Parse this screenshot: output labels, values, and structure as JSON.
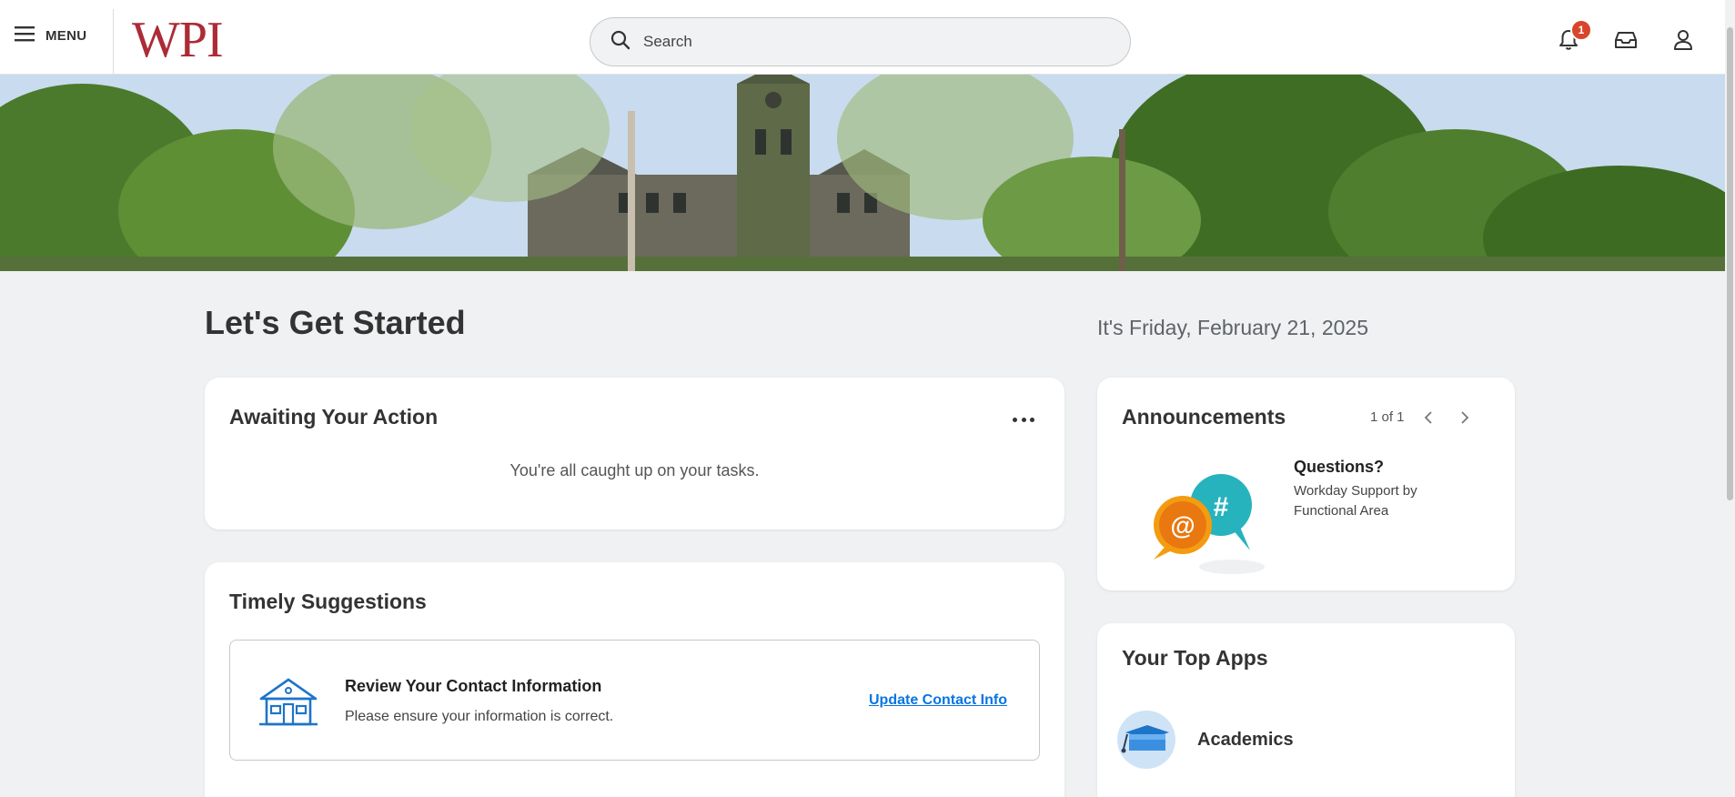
{
  "header": {
    "menu_label": "MENU",
    "logo_text": "WPI",
    "search_placeholder": "Search",
    "notification_count": "1"
  },
  "main": {
    "title": "Let's Get Started",
    "date": "It's Friday, February 21, 2025"
  },
  "awaiting": {
    "title": "Awaiting Your Action",
    "message": "You're all caught up on your tasks."
  },
  "timely": {
    "title": "Timely Suggestions",
    "suggestion_title": "Review Your Contact Information",
    "suggestion_text": "Please ensure your information is correct.",
    "suggestion_link": "Update Contact Info"
  },
  "announcements": {
    "title": "Announcements",
    "pager": "1 of 1",
    "item_title": "Questions?",
    "item_desc": "Workday Support by Functional Area"
  },
  "top_apps": {
    "title": "Your Top Apps",
    "apps": [
      {
        "label": "Academics"
      }
    ]
  },
  "colors": {
    "brand": "#ac2b37",
    "link": "#0875e1",
    "badge": "#d8452b"
  }
}
